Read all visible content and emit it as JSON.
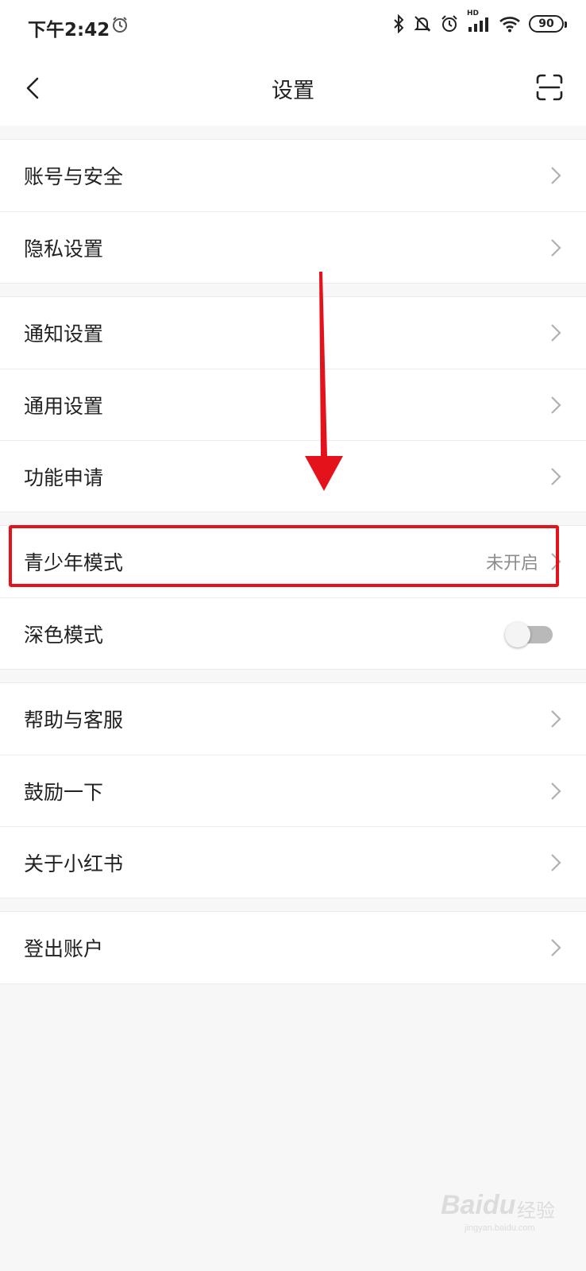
{
  "status_bar": {
    "time": "下午2:42",
    "battery": "90",
    "signal_badge": "HD",
    "icons": [
      "alarm-icon",
      "bluetooth-icon",
      "mute-icon",
      "alarm-icon",
      "signal-icon",
      "wifi-icon",
      "battery-icon"
    ]
  },
  "header": {
    "title": "设置",
    "back_icon": "back-chevron-icon",
    "scan_icon": "scan-icon"
  },
  "groups": [
    {
      "items": [
        {
          "label": "账号与安全"
        },
        {
          "label": "隐私设置"
        }
      ]
    },
    {
      "items": [
        {
          "label": "通知设置"
        },
        {
          "label": "通用设置"
        },
        {
          "label": "功能申请"
        }
      ]
    },
    {
      "items": [
        {
          "label": "青少年模式",
          "value": "未开启"
        },
        {
          "label": "深色模式",
          "toggle": false
        }
      ]
    },
    {
      "items": [
        {
          "label": "帮助与客服"
        },
        {
          "label": "鼓励一下"
        },
        {
          "label": "关于小红书"
        }
      ]
    },
    {
      "items": [
        {
          "label": "登出账户"
        }
      ]
    }
  ],
  "annotation": {
    "color": "#e4131b",
    "highlighted_item": "青少年模式"
  },
  "watermark": {
    "logo": "Baidu",
    "text": "经验",
    "url": "jingyan.baidu.com"
  }
}
